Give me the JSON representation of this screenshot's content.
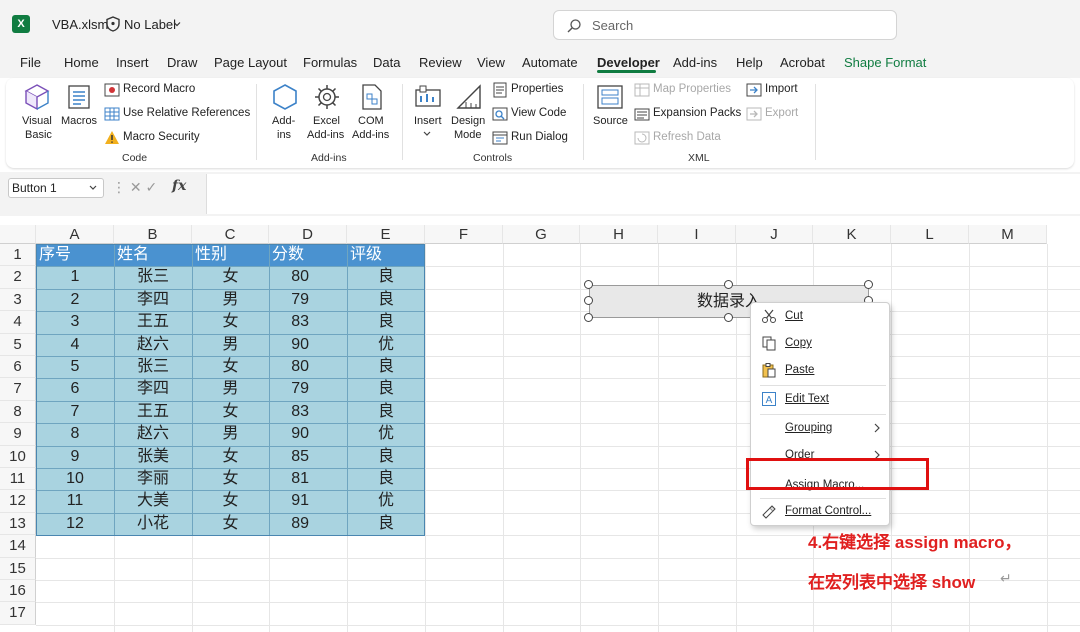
{
  "title_bar": {
    "filename": "VBA.xlsm",
    "label": "No Label",
    "search_placeholder": "Search"
  },
  "menu": [
    "File",
    "Home",
    "Insert",
    "Draw",
    "Page Layout",
    "Formulas",
    "Data",
    "Review",
    "View",
    "Automate",
    "Developer",
    "Add-ins",
    "Help",
    "Acrobat",
    "Shape Format"
  ],
  "ribbon": {
    "code": {
      "visual_basic": [
        "Visual",
        "Basic"
      ],
      "macros": "Macros",
      "record_macro": "Record Macro",
      "relative_refs": "Use Relative References",
      "macro_security": "Macro Security",
      "group": "Code"
    },
    "addins": {
      "add_ins": [
        "Add-",
        "ins"
      ],
      "excel_addins": [
        "Excel",
        "Add-ins"
      ],
      "com_addins": [
        "COM",
        "Add-ins"
      ],
      "group": "Add-ins"
    },
    "controls": {
      "insert": "Insert",
      "design_mode": [
        "Design",
        "Mode"
      ],
      "properties": "Properties",
      "view_code": "View Code",
      "run_dialog": "Run Dialog",
      "group": "Controls"
    },
    "xml": {
      "source": "Source",
      "map_properties": "Map Properties",
      "expansion_packs": "Expansion Packs",
      "refresh_data": "Refresh Data",
      "import": "Import",
      "export": "Export",
      "group": "XML"
    }
  },
  "formula_bar": {
    "name_box": "Button 1",
    "fx": "fx"
  },
  "columns": [
    "A",
    "B",
    "C",
    "D",
    "E",
    "F",
    "G",
    "H",
    "I",
    "J",
    "K",
    "L",
    "M"
  ],
  "rows": [
    "1",
    "2",
    "3",
    "4",
    "5",
    "6",
    "7",
    "8",
    "9",
    "10",
    "11",
    "12",
    "13",
    "14",
    "15",
    "16",
    "17"
  ],
  "table": {
    "headers": [
      "序号",
      "姓名",
      "性别",
      "分数",
      "评级"
    ],
    "rows": [
      [
        "1",
        "张三",
        "女",
        "80",
        "良"
      ],
      [
        "2",
        "李四",
        "男",
        "79",
        "良"
      ],
      [
        "3",
        "王五",
        "女",
        "83",
        "良"
      ],
      [
        "4",
        "赵六",
        "男",
        "90",
        "优"
      ],
      [
        "5",
        "张三",
        "女",
        "80",
        "良"
      ],
      [
        "6",
        "李四",
        "男",
        "79",
        "良"
      ],
      [
        "7",
        "王五",
        "女",
        "83",
        "良"
      ],
      [
        "8",
        "赵六",
        "男",
        "90",
        "优"
      ],
      [
        "9",
        "张美",
        "女",
        "85",
        "良"
      ],
      [
        "10",
        "李丽",
        "女",
        "81",
        "良"
      ],
      [
        "11",
        "大美",
        "女",
        "91",
        "优"
      ],
      [
        "12",
        "小花",
        "女",
        "89",
        "良"
      ]
    ]
  },
  "shape_button": {
    "text": "数据录入"
  },
  "context_menu": {
    "cut": "Cut",
    "copy": "Copy",
    "paste": "Paste",
    "edit_text": "Edit Text",
    "grouping": "Grouping",
    "order": "Order",
    "assign_macro": "Assign Macro...",
    "format_control": "Format Control..."
  },
  "annotation": {
    "line1": "4.右键选择 assign macro，",
    "line2": "在宏列表中选择 show"
  },
  "colors": {
    "accent": "#107c41",
    "table_header": "#4a92d0",
    "table_body": "#a9d3e0",
    "highlight": "#e01010"
  }
}
